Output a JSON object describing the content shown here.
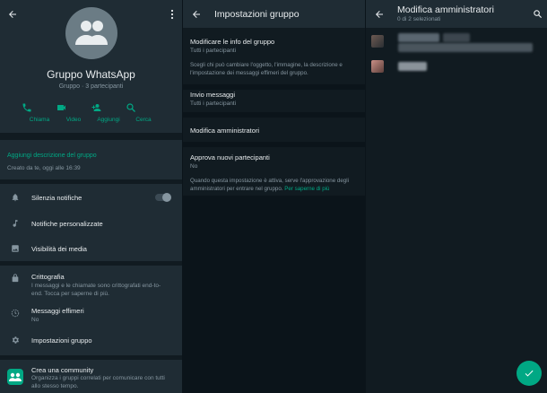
{
  "group_info": {
    "name": "Gruppo WhatsApp",
    "subtitle": "Gruppo · 3 partecipanti",
    "actions": [
      {
        "label": "Chiama",
        "icon": "phone-icon"
      },
      {
        "label": "Video",
        "icon": "video-icon"
      },
      {
        "label": "Aggiungi",
        "icon": "add-person-icon"
      },
      {
        "label": "Cerca",
        "icon": "search-icon"
      }
    ],
    "add_description": "Aggiungi descrizione del gruppo",
    "created": "Creato da te, oggi alle 16:39",
    "mute_notifications": "Silenzia notifiche",
    "mute_enabled": false,
    "custom_notifications": "Notifiche personalizzate",
    "media_visibility": "Visibilità dei media",
    "encryption_title": "Crittografia",
    "encryption_sub": "I messaggi e le chiamate sono crittografati end-to-end. Tocca per saperne di più.",
    "disappearing_title": "Messaggi effimeri",
    "disappearing_sub": "No",
    "group_settings": "Impostazioni gruppo",
    "community_title": "Crea una community",
    "community_sub": "Organizza i gruppi correlati per comunicare con tutti allo stesso tempo."
  },
  "group_settings": {
    "title": "Impostazioni gruppo",
    "edit_info_title": "Modificare le info del gruppo",
    "edit_info_value": "Tutti i partecipanti",
    "edit_info_desc": "Scegli chi può cambiare l'oggetto, l'immagine, la descrizione e l'impostazione dei messaggi effimeri del gruppo.",
    "send_messages_title": "Invio messaggi",
    "send_messages_value": "Tutti i partecipanti",
    "edit_admins": "Modifica amministratori",
    "approve_title": "Approva nuovi partecipanti",
    "approve_value": "No",
    "approve_desc": "Quando questa impostazione è attiva, serve l'approvazione degli amministratori per entrare nel gruppo.",
    "approve_link": "Per saperne di più"
  },
  "edit_admins": {
    "title": "Modifica amministratori",
    "count": "0 di 2 selezionati"
  },
  "colors": {
    "accent": "#00a884",
    "panel_bg": "#111b21",
    "header_bg": "#1f2c34",
    "secondary_text": "#8696a0"
  }
}
